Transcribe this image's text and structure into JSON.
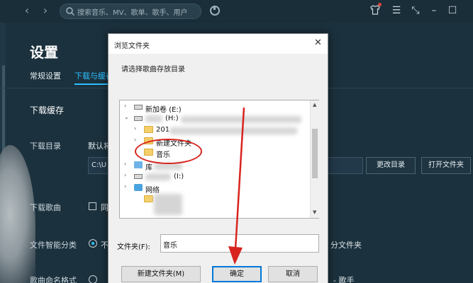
{
  "topbar": {
    "back_icon": "chevron-left-icon",
    "forward_icon": "chevron-right-icon",
    "search_placeholder": "搜索音乐、MV、歌单、歌手、用户",
    "accent": "#2ec0ff"
  },
  "settings": {
    "title": "设置",
    "tabs": [
      {
        "label": "常规设置"
      },
      {
        "label": "下载与缓存"
      }
    ],
    "section_title": "下载缓存",
    "rows": {
      "download_dir_label": "下载目录",
      "download_dir_default": "默认将",
      "download_dir_value": "C:\\U",
      "change_dir_button": "更改目录",
      "open_folder_button": "打开文件夹",
      "download_lyrics_label": "下载歌曲",
      "download_lyrics_option": "同",
      "smart_classify_label": "文件智能分类",
      "smart_classify_option": "不",
      "smart_classify_tail": "分文件夹",
      "naming_label": "歌曲命名格式",
      "naming_tail": "- 歌手"
    }
  },
  "dialog": {
    "title": "浏览文件夹",
    "prompt": "请选择歌曲存放目录",
    "tree": [
      {
        "label": "新加卷 (E:)",
        "type": "drive"
      },
      {
        "label": "(H:)",
        "type": "drive"
      },
      {
        "label": "201",
        "type": "folder"
      },
      {
        "label": "新建文件夹",
        "type": "folder"
      },
      {
        "label": "音乐",
        "type": "folder"
      },
      {
        "label": "库",
        "type": "library"
      },
      {
        "label": "(I:)",
        "type": "drive"
      },
      {
        "label": "网络",
        "type": "network"
      }
    ],
    "folder_label": "文件夹(F):",
    "folder_value": "音乐",
    "new_folder_button": "新建文件夹(M)",
    "ok_button": "确定",
    "cancel_button": "取消",
    "annotation_color": "#d8241f"
  }
}
